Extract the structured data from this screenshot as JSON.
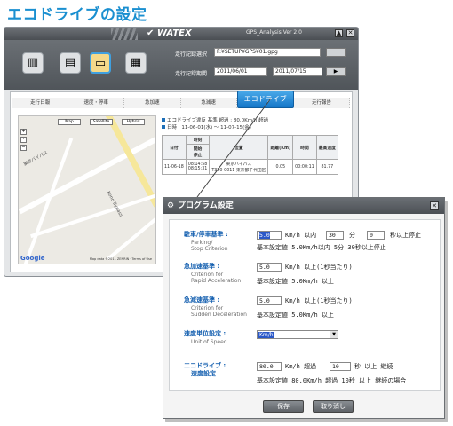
{
  "page_title": "エコドライブの設定",
  "window": {
    "brand": "WATEX",
    "version": "GPS_Analysis Ver 2.0",
    "btn_min": "▲",
    "btn_close": "✕"
  },
  "toolbar": {
    "file_label": "走行記録選択",
    "file_path": "F:¥SETUP¥GPS¥01.gpg",
    "file_btn": "···",
    "period_label": "走行記録期間",
    "date_from": "2011/06/01",
    "date_to": "2011/07/15",
    "go_btn": "▶"
  },
  "tabs": [
    "走行日報",
    "速度・停車",
    "急加速",
    "急減速",
    "エコドライブ",
    "走行報告"
  ],
  "map": {
    "btn_map": "Map",
    "btn_sat": "Satellite",
    "btn_hybrid": "Hybrid",
    "road1": "東京バイパス",
    "road2": "Kono Bypass",
    "google": "Google",
    "copyright": "Map data ©2011 ZENRIN · Terms of Use"
  },
  "info": {
    "line1": "エコドライブ違反 基準 超過 : 80.0Km/h 超過",
    "line2": "日時 : 11-06-01(水) ～ 11-07-15(金)"
  },
  "result_table": {
    "headers": [
      "日付",
      "時刻",
      "位置",
      "距離(Km)",
      "時間",
      "最高速度"
    ],
    "sub_headers": [
      "開始",
      "停止"
    ],
    "row": [
      "11-06-18",
      "08:14:58",
      "08:15:31",
      "東京バイパス",
      "T370-0011 東京都千代田区",
      "0.05",
      "00:00:11",
      "81.77"
    ]
  },
  "dialog": {
    "title": "プログラム設定",
    "close": "✕",
    "parking": {
      "label_ja": "駐車/停車基準 :",
      "label_en1": "Parking/",
      "label_en2": "Stop Criterion",
      "speed": "5.0",
      "t1": "Km/h 以内",
      "minutes": "30",
      "t2": "分",
      "seconds": "0",
      "t3": "秒以上停止",
      "default": "基本設定値 5.0Km/h以内 5分 30秒以上停止"
    },
    "accel": {
      "label_ja": "急加速基準 :",
      "label_en1": "Criterion for",
      "label_en2": "Rapid Acceleration",
      "value": "5.0",
      "unit": "Km/h 以上(1秒当たり)",
      "default": "基本設定値 5.0Km/h 以上"
    },
    "decel": {
      "label_ja": "急減速基準 :",
      "label_en1": "Criterion for",
      "label_en2": "Sudden Deceleration",
      "value": "5.0",
      "unit": "Km/h 以上(1秒当たり)",
      "default": "基本設定値 5.0Km/h 以上"
    },
    "speed_unit": {
      "label_ja": "速度単位設定 :",
      "label_en": "Unit of Speed",
      "value": "Km/h"
    },
    "eco": {
      "label_ja1": "エコドライブ :",
      "label_ja2": "速度設定",
      "speed": "80.0",
      "t1": "Km/h 超過",
      "seconds": "10",
      "t2": "秒 以上 継続",
      "default": "基本設定値 80.0Km/h 超過 10秒 以上 継続の場合"
    },
    "save": "保存",
    "cancel": "取り消し"
  },
  "colors": {
    "accent": "#1a8fd0",
    "label_blue": "#1560b0"
  }
}
